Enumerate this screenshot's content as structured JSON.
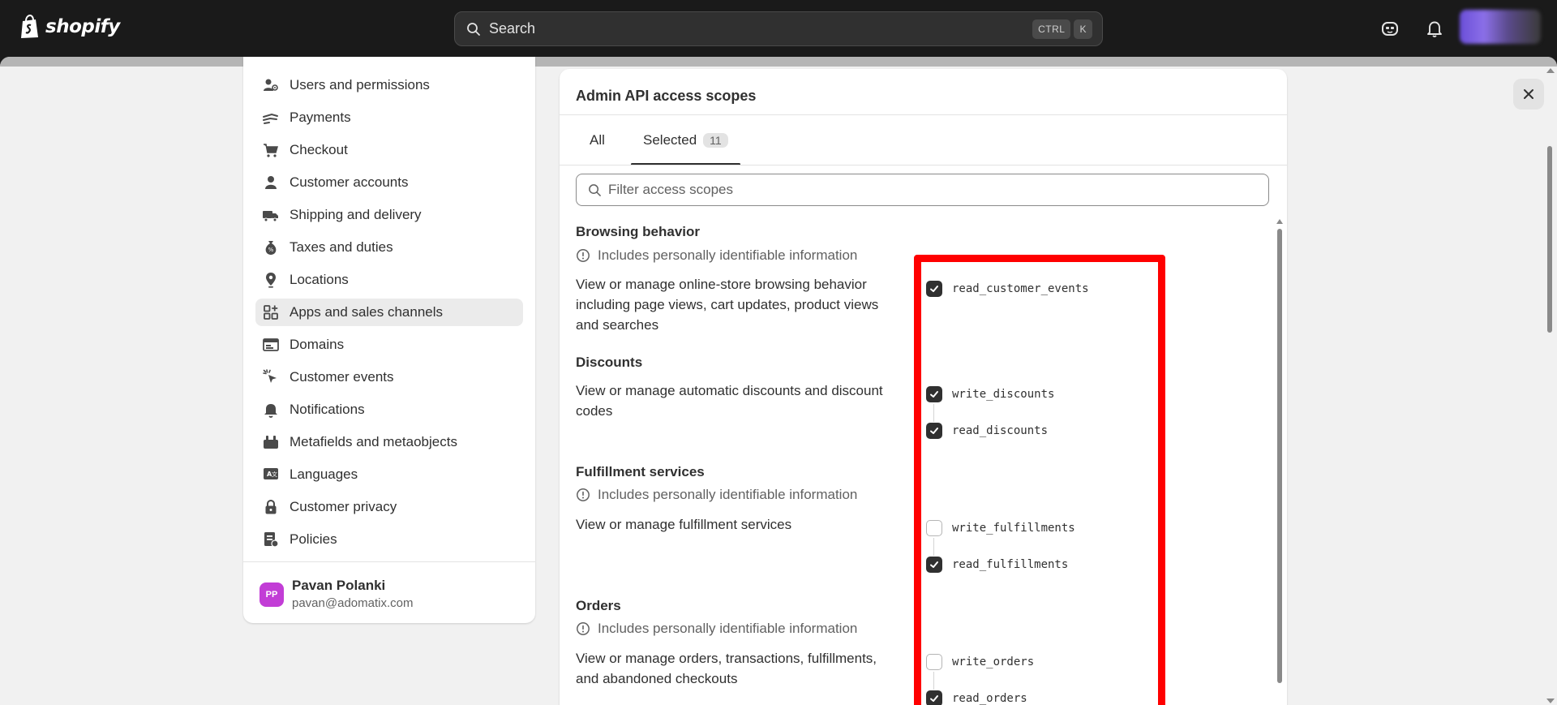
{
  "topbar": {
    "logo_text": "shopify",
    "search": {
      "label": "Search",
      "shortcut_keys": [
        "CTRL",
        "K"
      ]
    }
  },
  "nav": {
    "items": [
      {
        "label": "Users and permissions",
        "icon": "users-icon"
      },
      {
        "label": "Payments",
        "icon": "payments-icon"
      },
      {
        "label": "Checkout",
        "icon": "cart-icon"
      },
      {
        "label": "Customer accounts",
        "icon": "person-icon"
      },
      {
        "label": "Shipping and delivery",
        "icon": "truck-icon"
      },
      {
        "label": "Taxes and duties",
        "icon": "tax-icon"
      },
      {
        "label": "Locations",
        "icon": "location-icon"
      },
      {
        "label": "Apps and sales channels",
        "icon": "apps-icon",
        "active": true
      },
      {
        "label": "Domains",
        "icon": "domains-icon"
      },
      {
        "label": "Customer events",
        "icon": "cursor-click-icon"
      },
      {
        "label": "Notifications",
        "icon": "bell-icon"
      },
      {
        "label": "Metafields and metaobjects",
        "icon": "metafields-icon"
      },
      {
        "label": "Languages",
        "icon": "languages-icon"
      },
      {
        "label": "Customer privacy",
        "icon": "lock-icon"
      },
      {
        "label": "Policies",
        "icon": "policies-icon"
      }
    ],
    "user": {
      "initials": "PP",
      "name": "Pavan Polanki",
      "email": "pavan@adomatix.com"
    }
  },
  "panel": {
    "title": "Admin API access scopes",
    "tabs": {
      "all": "All",
      "selected": "Selected",
      "selected_count": "11"
    },
    "filter_placeholder": "Filter access scopes",
    "pii_text": "Includes personally identifiable information",
    "sections": [
      {
        "title": "Browsing behavior",
        "pii": true,
        "description": "View or manage online-store browsing behavior including page views, cart updates, product views and searches",
        "scopes": [
          {
            "name": "read_customer_events",
            "checked": true
          }
        ]
      },
      {
        "title": "Discounts",
        "pii": false,
        "description": "View or manage automatic discounts and discount codes",
        "scopes": [
          {
            "name": "write_discounts",
            "checked": true
          },
          {
            "name": "read_discounts",
            "checked": true
          }
        ]
      },
      {
        "title": "Fulfillment services",
        "pii": true,
        "description": "View or manage fulfillment services",
        "scopes": [
          {
            "name": "write_fulfillments",
            "checked": false
          },
          {
            "name": "read_fulfillments",
            "checked": true
          }
        ]
      },
      {
        "title": "Orders",
        "pii": true,
        "description": "View or manage orders, transactions, fulfillments, and abandoned checkouts",
        "scopes": [
          {
            "name": "write_orders",
            "checked": false
          },
          {
            "name": "read_orders",
            "checked": true
          }
        ]
      }
    ]
  },
  "colors": {
    "topbar": "#1a1a1a",
    "highlight": "#ff0000",
    "avatar": "#c23dd6"
  }
}
